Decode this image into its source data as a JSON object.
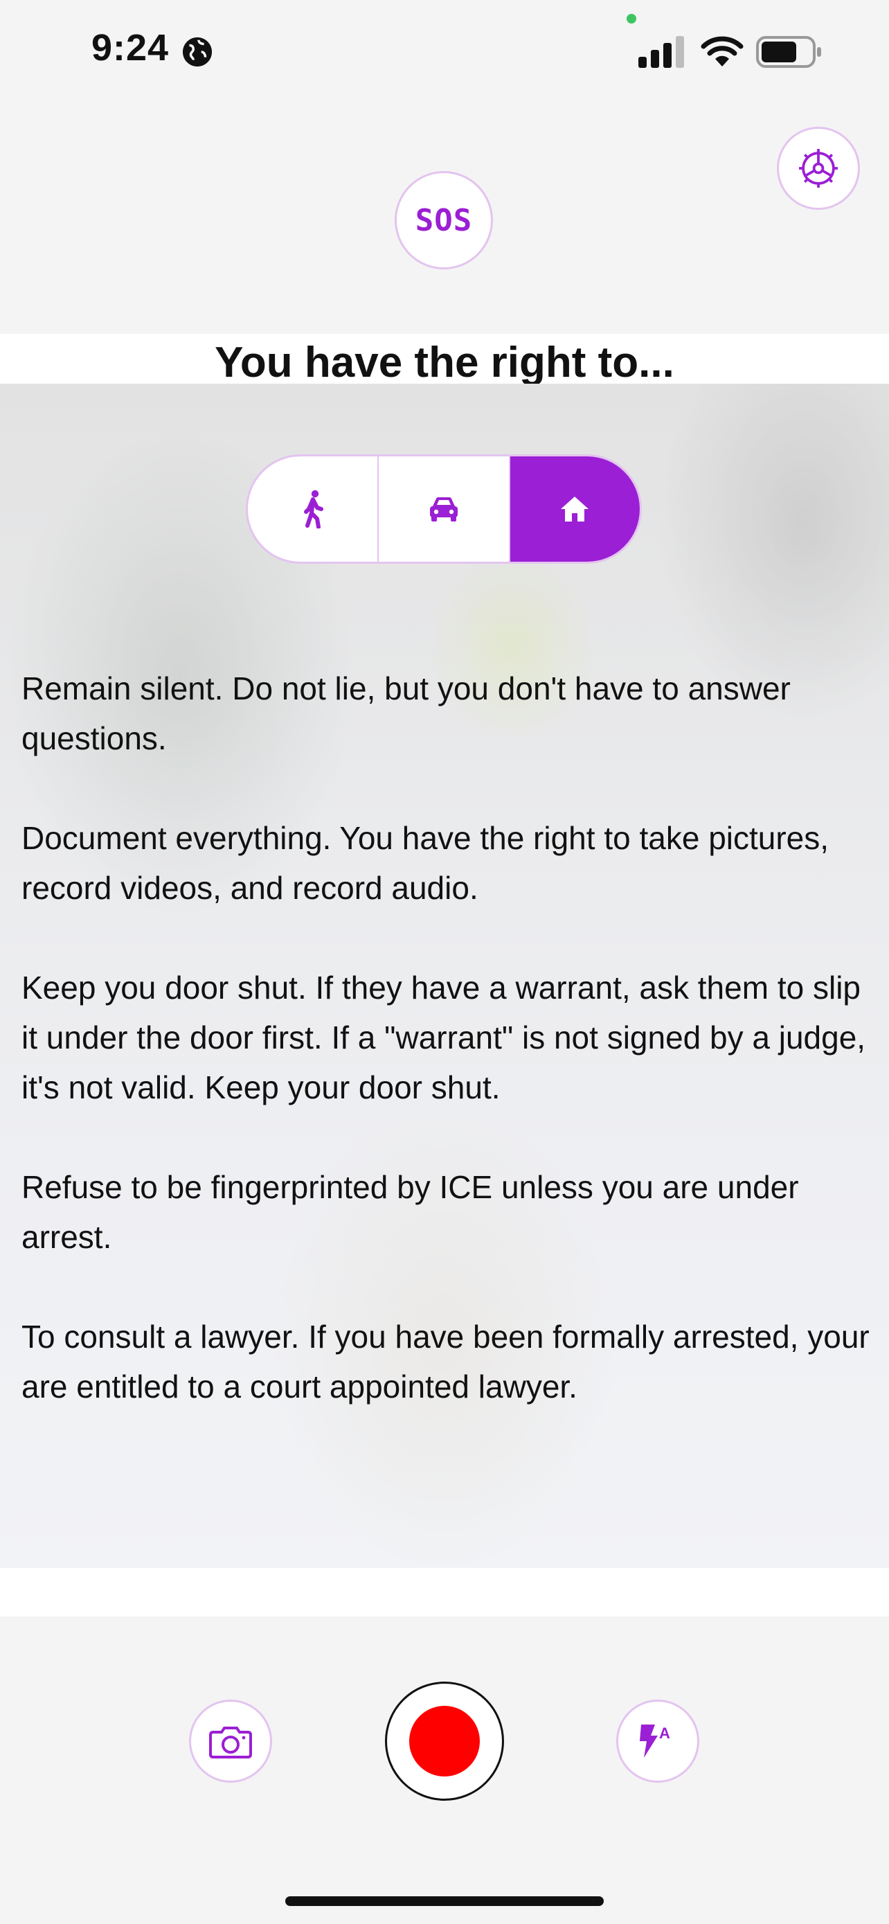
{
  "status_bar": {
    "time": "9:24"
  },
  "header": {
    "sos_label": "SOS"
  },
  "title": "You have the right to...",
  "segmented_control": {
    "options": [
      "walking",
      "car",
      "home"
    ],
    "selected": "home"
  },
  "rights": [
    "Remain silent. Do not lie, but you don't have to answer questions.",
    "Document everything. You have the right to take pictures, record videos, and record audio.",
    "Keep you door shut. If they have a warrant, ask them to slip it under the door first. If a \"warrant\" is not signed by a judge, it's not valid. Keep your door shut.",
    "Refuse to be fingerprinted by ICE unless you are under arrest.",
    "To consult a lawyer. If you have been formally arrested, your are entitled to a court appointed lawyer."
  ],
  "colors": {
    "accent": "#9b1fd4",
    "accent_border": "#e3c4ef",
    "record": "#ff0000"
  },
  "icons": {
    "settings": "gear-icon",
    "walking": "walking-person-icon",
    "car": "car-icon",
    "home": "home-icon",
    "camera": "camera-icon",
    "flash": "flash-auto-icon"
  }
}
